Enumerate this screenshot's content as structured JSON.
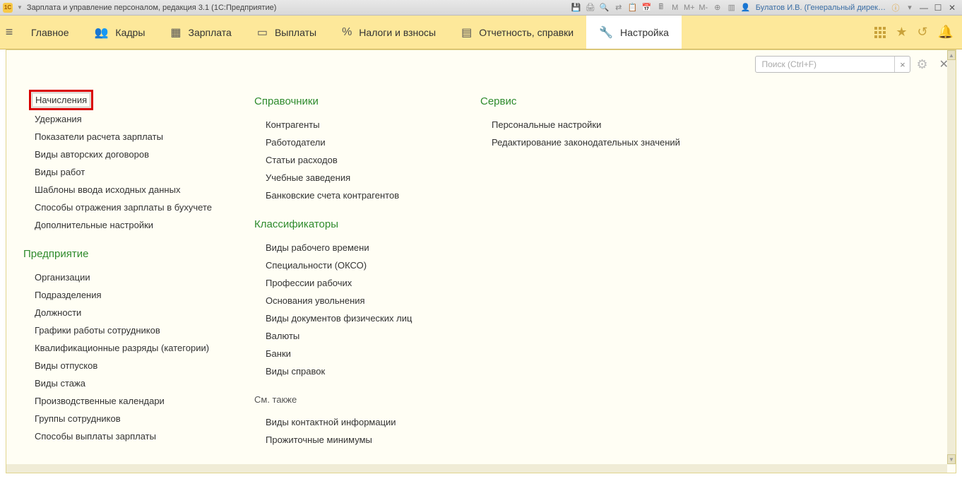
{
  "titlebar": {
    "logo_text": "1C",
    "title": "Зарплата и управление персоналом, редакция 3.1  (1С:Предприятие)",
    "user": "Булатов И.В. (Генеральный дирек…",
    "m_label": "M",
    "m_plus": "M+",
    "m_minus": "M-"
  },
  "nav": {
    "items": [
      {
        "label": "Главное"
      },
      {
        "label": "Кадры"
      },
      {
        "label": "Зарплата"
      },
      {
        "label": "Выплаты"
      },
      {
        "label": "Налоги и взносы"
      },
      {
        "label": "Отчетность, справки"
      },
      {
        "label": "Настройка"
      }
    ]
  },
  "search": {
    "placeholder": "Поиск (Ctrl+F)",
    "clear": "×"
  },
  "col1": {
    "group1": [
      "Начисления",
      "Удержания",
      "Показатели расчета зарплаты",
      "Виды авторских договоров",
      "Виды работ",
      "Шаблоны ввода исходных данных",
      "Способы отражения зарплаты в бухучете",
      "Дополнительные настройки"
    ],
    "section2_title": "Предприятие",
    "group2": [
      "Организации",
      "Подразделения",
      "Должности",
      "Графики работы сотрудников",
      "Квалификационные разряды (категории)",
      "Виды отпусков",
      "Виды стажа",
      "Производственные календари",
      "Группы сотрудников",
      "Способы выплаты зарплаты"
    ]
  },
  "col2": {
    "section1_title": "Справочники",
    "group1": [
      "Контрагенты",
      "Работодатели",
      "Статьи расходов",
      "Учебные заведения",
      "Банковские счета контрагентов"
    ],
    "section2_title": "Классификаторы",
    "group2": [
      "Виды рабочего времени",
      "Специальности (ОКСО)",
      "Профессии рабочих",
      "Основания увольнения",
      "Виды документов физических лиц",
      "Валюты",
      "Банки",
      "Виды справок"
    ],
    "section3_title": "См. также",
    "group3": [
      "Виды контактной информации",
      "Прожиточные минимумы"
    ]
  },
  "col3": {
    "section1_title": "Сервис",
    "group1": [
      "Персональные настройки",
      "Редактирование законодательных значений"
    ]
  }
}
